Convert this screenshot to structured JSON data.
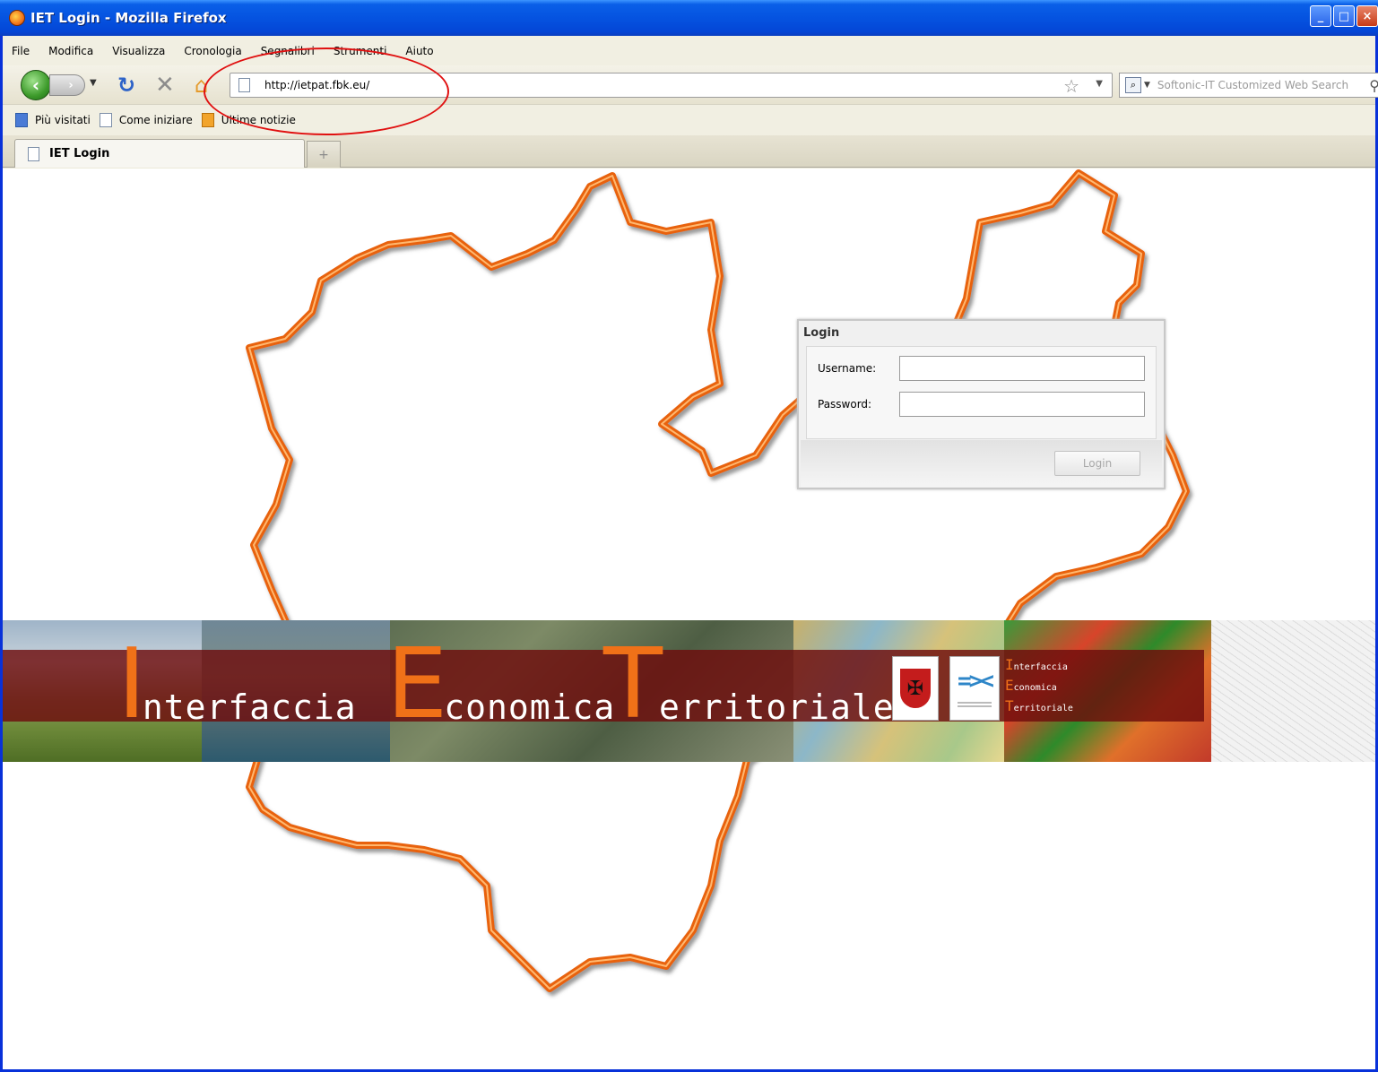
{
  "window": {
    "title": "IET Login - Mozilla Firefox"
  },
  "menubar": {
    "items": [
      "File",
      "Modifica",
      "Visualizza",
      "Cronologia",
      "Segnalibri",
      "Strumenti",
      "Aiuto"
    ]
  },
  "navbar": {
    "url": "http://ietpat.fbk.eu/"
  },
  "search": {
    "placeholder": "Softonic-IT Customized Web Search"
  },
  "bookmarks": {
    "items": [
      "Più visitati",
      "Come iniziare",
      "Ultime notizie"
    ]
  },
  "tabs": {
    "active_label": "IET Login",
    "new_tab": "+"
  },
  "banner": {
    "word1_cap": "I",
    "word1_rest": "nterfaccia",
    "word2_cap": "E",
    "word2_rest": "conomica",
    "word3_cap": "T",
    "word3_rest": "erritoriale",
    "mini1_cap": "I",
    "mini1_rest": "nterfaccia",
    "mini2_cap": "E",
    "mini2_rest": "conomica",
    "mini3_cap": "T",
    "mini3_rest": "erritoriale"
  },
  "login": {
    "title": "Login",
    "username_label": "Username:",
    "password_label": "Password:",
    "username_value": "",
    "password_value": "",
    "button_label": "Login"
  },
  "colors": {
    "accent_orange": "#f07118",
    "annotation_red": "#e01010",
    "xp_blue": "#0553e0"
  }
}
